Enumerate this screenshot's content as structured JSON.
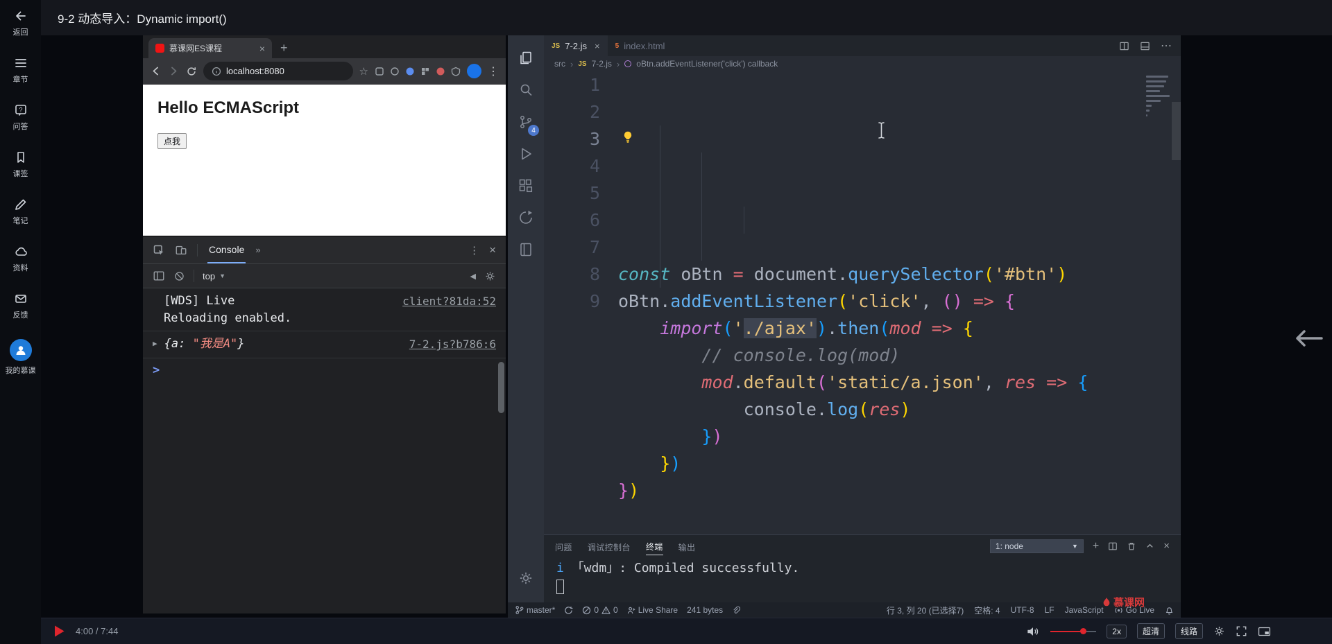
{
  "page": {
    "title": "9-2 动态导入：Dynamic import()"
  },
  "sidebar": {
    "items": [
      {
        "label": "返回"
      },
      {
        "label": "章节"
      },
      {
        "label": "问答"
      },
      {
        "label": "课签"
      },
      {
        "label": "笔记"
      },
      {
        "label": "资料"
      },
      {
        "label": "反馈"
      },
      {
        "label": "我的慕课"
      }
    ]
  },
  "browser": {
    "tab_title": "慕课网ES课程",
    "url": "localhost:8080",
    "content": {
      "heading": "Hello ECMAScript",
      "button": "点我"
    },
    "devtools": {
      "tab": "Console",
      "more_tabs": "»",
      "context": "top",
      "logs": [
        {
          "message": "[WDS] Live Reloading enabled.",
          "source": "client?81da:52"
        },
        {
          "obj_open": "{a: ",
          "obj_string": "\"我是A\"",
          "obj_close": "}",
          "source": "7-2.js?b786:6"
        }
      ],
      "prompt": ">"
    }
  },
  "vscode": {
    "activity_badge": "4",
    "tabs": [
      {
        "label": "7-2.js",
        "badge": "JS"
      },
      {
        "label": "index.html",
        "badge": "5"
      }
    ],
    "breadcrumb": {
      "root": "src",
      "file_badge": "JS",
      "file": "7-2.js",
      "symbol": "oBtn.addEventListener('click') callback"
    },
    "code": {
      "lines": [
        {
          "num": "1",
          "tokens": [
            {
              "t": "const",
              "s": "kw"
            },
            {
              "t": " oBtn ",
              "s": "fg"
            },
            {
              "t": "=",
              "s": "op"
            },
            {
              "t": " document.",
              "s": "fg"
            },
            {
              "t": "querySelector",
              "s": "fn"
            },
            {
              "t": "(",
              "s": "b1"
            },
            {
              "t": "'#btn'",
              "s": "str"
            },
            {
              "t": ")",
              "s": "b1"
            }
          ]
        },
        {
          "num": "2",
          "tokens": [
            {
              "t": "oBtn.",
              "s": "fg"
            },
            {
              "t": "addEventListener",
              "s": "fn"
            },
            {
              "t": "(",
              "s": "b1"
            },
            {
              "t": "'click'",
              "s": "str"
            },
            {
              "t": ", ",
              "s": "fg"
            },
            {
              "t": "(",
              "s": "b2"
            },
            {
              "t": ")",
              "s": "b2"
            },
            {
              "t": " ",
              "s": "fg"
            },
            {
              "t": "=>",
              "s": "op"
            },
            {
              "t": " ",
              "s": "fg"
            },
            {
              "t": "{",
              "s": "b2"
            }
          ]
        },
        {
          "num": "3",
          "active": true,
          "tokens": [
            {
              "t": "    ",
              "s": "fg"
            },
            {
              "t": "import",
              "s": "imp"
            },
            {
              "t": "(",
              "s": "b3"
            },
            {
              "t": "'",
              "s": "str"
            },
            {
              "t": "./ajax'",
              "s": "str",
              "sel": true
            },
            {
              "t": ")",
              "s": "b3"
            },
            {
              "t": ".",
              "s": "fg"
            },
            {
              "t": "then",
              "s": "fn"
            },
            {
              "t": "(",
              "s": "b3"
            },
            {
              "t": "mod",
              "s": "param"
            },
            {
              "t": " ",
              "s": "fg"
            },
            {
              "t": "=>",
              "s": "op"
            },
            {
              "t": " ",
              "s": "fg"
            },
            {
              "t": "{",
              "s": "b1"
            }
          ]
        },
        {
          "num": "4",
          "tokens": [
            {
              "t": "        ",
              "s": "fg"
            },
            {
              "t": "// console.log(mod)",
              "s": "com"
            }
          ]
        },
        {
          "num": "5",
          "tokens": [
            {
              "t": "        ",
              "s": "fg"
            },
            {
              "t": "mod",
              "s": "param"
            },
            {
              "t": ".",
              "s": "fg"
            },
            {
              "t": "default",
              "s": "deflt"
            },
            {
              "t": "(",
              "s": "b2"
            },
            {
              "t": "'static/a.json'",
              "s": "str"
            },
            {
              "t": ", ",
              "s": "fg"
            },
            {
              "t": "res",
              "s": "param"
            },
            {
              "t": " ",
              "s": "fg"
            },
            {
              "t": "=>",
              "s": "op"
            },
            {
              "t": " ",
              "s": "fg"
            },
            {
              "t": "{",
              "s": "b3"
            }
          ]
        },
        {
          "num": "6",
          "tokens": [
            {
              "t": "            ",
              "s": "fg"
            },
            {
              "t": "console.",
              "s": "fg"
            },
            {
              "t": "log",
              "s": "fn"
            },
            {
              "t": "(",
              "s": "b1"
            },
            {
              "t": "res",
              "s": "param"
            },
            {
              "t": ")",
              "s": "b1"
            }
          ]
        },
        {
          "num": "7",
          "tokens": [
            {
              "t": "        ",
              "s": "fg"
            },
            {
              "t": "}",
              "s": "b3"
            },
            {
              "t": ")",
              "s": "b2"
            }
          ]
        },
        {
          "num": "8",
          "tokens": [
            {
              "t": "    ",
              "s": "fg"
            },
            {
              "t": "}",
              "s": "b1"
            },
            {
              "t": ")",
              "s": "b3"
            }
          ]
        },
        {
          "num": "9",
          "tokens": [
            {
              "t": "}",
              "s": "b2"
            },
            {
              "t": ")",
              "s": "b1"
            }
          ]
        }
      ]
    },
    "panel": {
      "tabs": [
        "问题",
        "调试控制台",
        "终端",
        "输出"
      ],
      "shell": "1: node",
      "output": {
        "prefix": "i",
        "tag": "「wdm」",
        "text": ": Compiled successfully."
      }
    },
    "status": {
      "branch": "master*",
      "errors": "0",
      "warnings": "0",
      "live_share": "Live Share",
      "size": "241 bytes",
      "cursor": "行 3, 列 20 (已选择7)",
      "indent": "空格: 4",
      "encoding": "UTF-8",
      "eol": "LF",
      "language": "JavaScript",
      "go_live": "Go Live"
    }
  },
  "player": {
    "time": "4:00 / 7:44",
    "speed": "2x",
    "quality": "超清",
    "route": "线路"
  },
  "watermark": "慕课网"
}
